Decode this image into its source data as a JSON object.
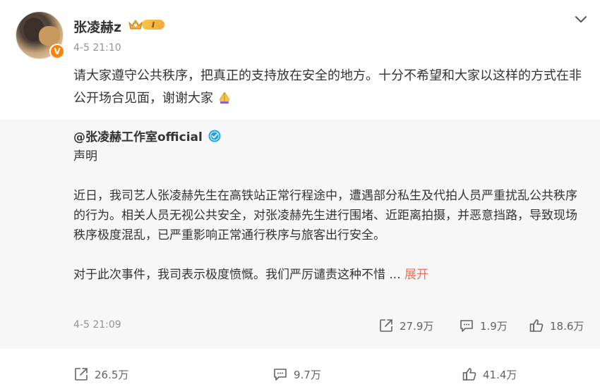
{
  "post": {
    "username": "张凌赫z",
    "vip_level": "I",
    "time": "4-5 21:10",
    "text": "请大家遵守公共秩序，把真正的支持放在安全的地方。十分不希望和大家以这样的方式在非公开场合见面，谢谢大家"
  },
  "repost": {
    "author": "@张凌赫工作室official",
    "paragraph1": "声明",
    "paragraph2": "近日，我司艺人张凌赫先生在高铁站正常行程途中，遭遇部分私生及代拍人员严重扰乱公共秩序的行为。相关人员无视公共安全，对张凌赫先生进行围堵、近距离拍摄，并恶意挡路，导致现场秩序极度混乱，已严重影响正常通行秩序与旅客出行安全。",
    "paragraph3": "对于此次事件，我司表示极度愤慨。我们严厉谴责这种不惜 ... ",
    "expand_label": "展开",
    "time": "4-5 21:09",
    "reposts": "27.9万",
    "comments": "1.9万",
    "likes": "18.6万"
  },
  "actions": {
    "reposts": "26.5万",
    "comments": "9.7万",
    "likes": "41.4万"
  },
  "colors": {
    "accent_orange": "#ff8200",
    "link_orange": "#eb7350",
    "verified_blue": "#1da1f2",
    "muted_text": "#939393",
    "repost_bg": "#f7f7f7"
  },
  "icons": [
    "chevron-down-icon",
    "crown-icon",
    "verified-v-icon",
    "pray-emoji-icon",
    "blue-verified-icon",
    "repost-icon",
    "comment-icon",
    "like-icon"
  ]
}
